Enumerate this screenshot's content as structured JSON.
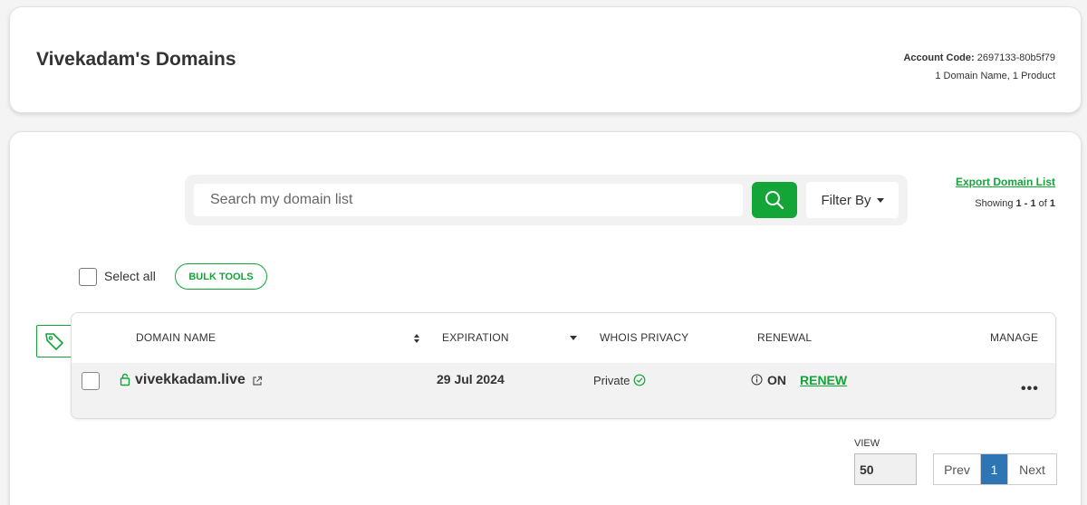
{
  "header": {
    "title": "Vivekadam's Domains",
    "account_label": "Account Code:",
    "account_code": "2697133-80b5f79",
    "summary": "1 Domain Name, 1 Product"
  },
  "search": {
    "placeholder": "Search my domain list",
    "filter_label": "Filter By"
  },
  "export": {
    "link_label": "Export Domain List",
    "showing_prefix": "Showing",
    "showing_range": "1 - 1",
    "showing_of": "of",
    "showing_total": "1"
  },
  "bulk": {
    "select_all_label": "Select all",
    "bulk_tools_label": "BULK TOOLS"
  },
  "table": {
    "headers": {
      "domain": "DOMAIN NAME",
      "expiration": "EXPIRATION",
      "privacy": "WHOIS PRIVACY",
      "renewal": "RENEWAL",
      "manage": "MANAGE"
    },
    "rows": [
      {
        "domain": "vivekkadam.live",
        "expiration": "29 Jul 2024",
        "privacy": "Private",
        "renewal_status": "ON",
        "renew_label": "RENEW",
        "manage": "•••"
      }
    ]
  },
  "pagination": {
    "view_label": "VIEW",
    "view_value": "50",
    "prev": "Prev",
    "current": "1",
    "next": "Next"
  },
  "colors": {
    "accent": "#13a538",
    "active_page": "#2e75b6"
  },
  "icons": [
    "search-icon",
    "caret-down-icon",
    "tag-icon",
    "lock-icon",
    "external-link-icon",
    "sort-icon",
    "check-circle-icon",
    "info-icon",
    "more-icon"
  ]
}
